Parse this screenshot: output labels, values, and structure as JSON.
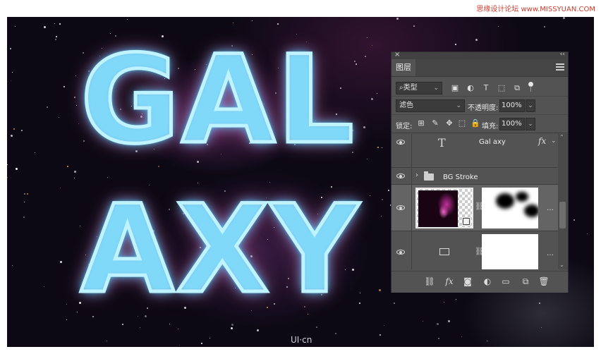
{
  "watermarks": {
    "top_right": "思缘设计论坛 www.MISSYUAN.COM",
    "bottom_center": "UI·cn"
  },
  "artwork": {
    "text_line1": "GAL",
    "text_line2": "AXY"
  },
  "panel": {
    "close_glyph": "×",
    "collapse_glyph": "‹‹",
    "tab_label": "图层",
    "filter": {
      "kind_value": "类型",
      "icons": [
        "image-filter-icon",
        "adjustment-filter-icon",
        "type-filter-icon",
        "shape-filter-icon",
        "smart-object-filter-icon"
      ]
    },
    "blend_mode": "滤色",
    "opacity_label": "不透明度:",
    "opacity_value": "100%",
    "lock_label": "锁定:",
    "fill_label": "填充:",
    "fill_value": "100%",
    "layers": [
      {
        "name": "Gal axy",
        "kind": "type",
        "fx": "fx"
      },
      {
        "name": "BG Stroke",
        "kind": "group"
      },
      {
        "name": "",
        "kind": "smart-object-with-mask"
      },
      {
        "name": "",
        "kind": "solid-color-fill"
      }
    ],
    "more_glyph": "…",
    "bottom_icons": [
      "link-layers-icon",
      "fx-icon",
      "add-mask-icon",
      "adjustment-layer-icon",
      "new-group-icon",
      "new-layer-icon",
      "delete-icon"
    ]
  },
  "colors": {
    "panel_bg": "#535353",
    "glow_cyan": "#5fe9ff",
    "selected_row": "#646464"
  }
}
